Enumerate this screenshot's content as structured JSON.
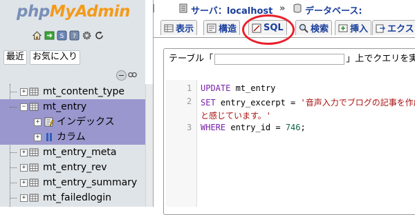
{
  "logo": {
    "part1": "php",
    "part2": "MyAdmin"
  },
  "nav_icons": [
    "home-icon",
    "exit-icon",
    "query-window-icon",
    "docs-icon",
    "settings-icon",
    "reload-icon"
  ],
  "nav_tabs": [
    {
      "label": "最近"
    },
    {
      "label": "お気に入り"
    }
  ],
  "tree": [
    {
      "label": "mt_content_type",
      "type": "table",
      "expanded": false
    },
    {
      "label": "mt_entry",
      "type": "table",
      "expanded": true,
      "selected": true
    },
    {
      "label": "インデックス",
      "type": "indexes",
      "expanded": false,
      "child": true
    },
    {
      "label": "カラム",
      "type": "columns",
      "expanded": false,
      "child": true
    },
    {
      "label": "mt_entry_meta",
      "type": "table",
      "expanded": false
    },
    {
      "label": "mt_entry_rev",
      "type": "table",
      "expanded": false
    },
    {
      "label": "mt_entry_summary",
      "type": "table",
      "expanded": false
    },
    {
      "label": "mt_failedlogin",
      "type": "table",
      "expanded": false
    }
  ],
  "breadcrumb": {
    "server": "サーバ：localhost",
    "sep": "»",
    "database": "データベース:"
  },
  "tabs": [
    {
      "label": "表示"
    },
    {
      "label": "構造"
    },
    {
      "label": "SQL"
    },
    {
      "label": "検索"
    },
    {
      "label": "挿入"
    },
    {
      "label": "エクス"
    }
  ],
  "active_tab": "SQL",
  "query_legend": {
    "before": "テーブル「",
    "after": "」上でクエリを実"
  },
  "editor": {
    "lines": [
      {
        "num": "1",
        "text": "UPDATE mt_entry"
      },
      {
        "num": "2",
        "text": "SET entry_excerpt = '音声入力でブログの記事を作成"
      },
      {
        "num": "",
        "text": "と感じています。'"
      },
      {
        "num": "3",
        "text": "WHERE entry_id = 746;"
      }
    ]
  },
  "colors": {
    "accent": "#1a3e9b",
    "selected_row": "#9a97cf",
    "highlight_ring": "#e8202a",
    "nav_bg": "#dfe4e8"
  }
}
